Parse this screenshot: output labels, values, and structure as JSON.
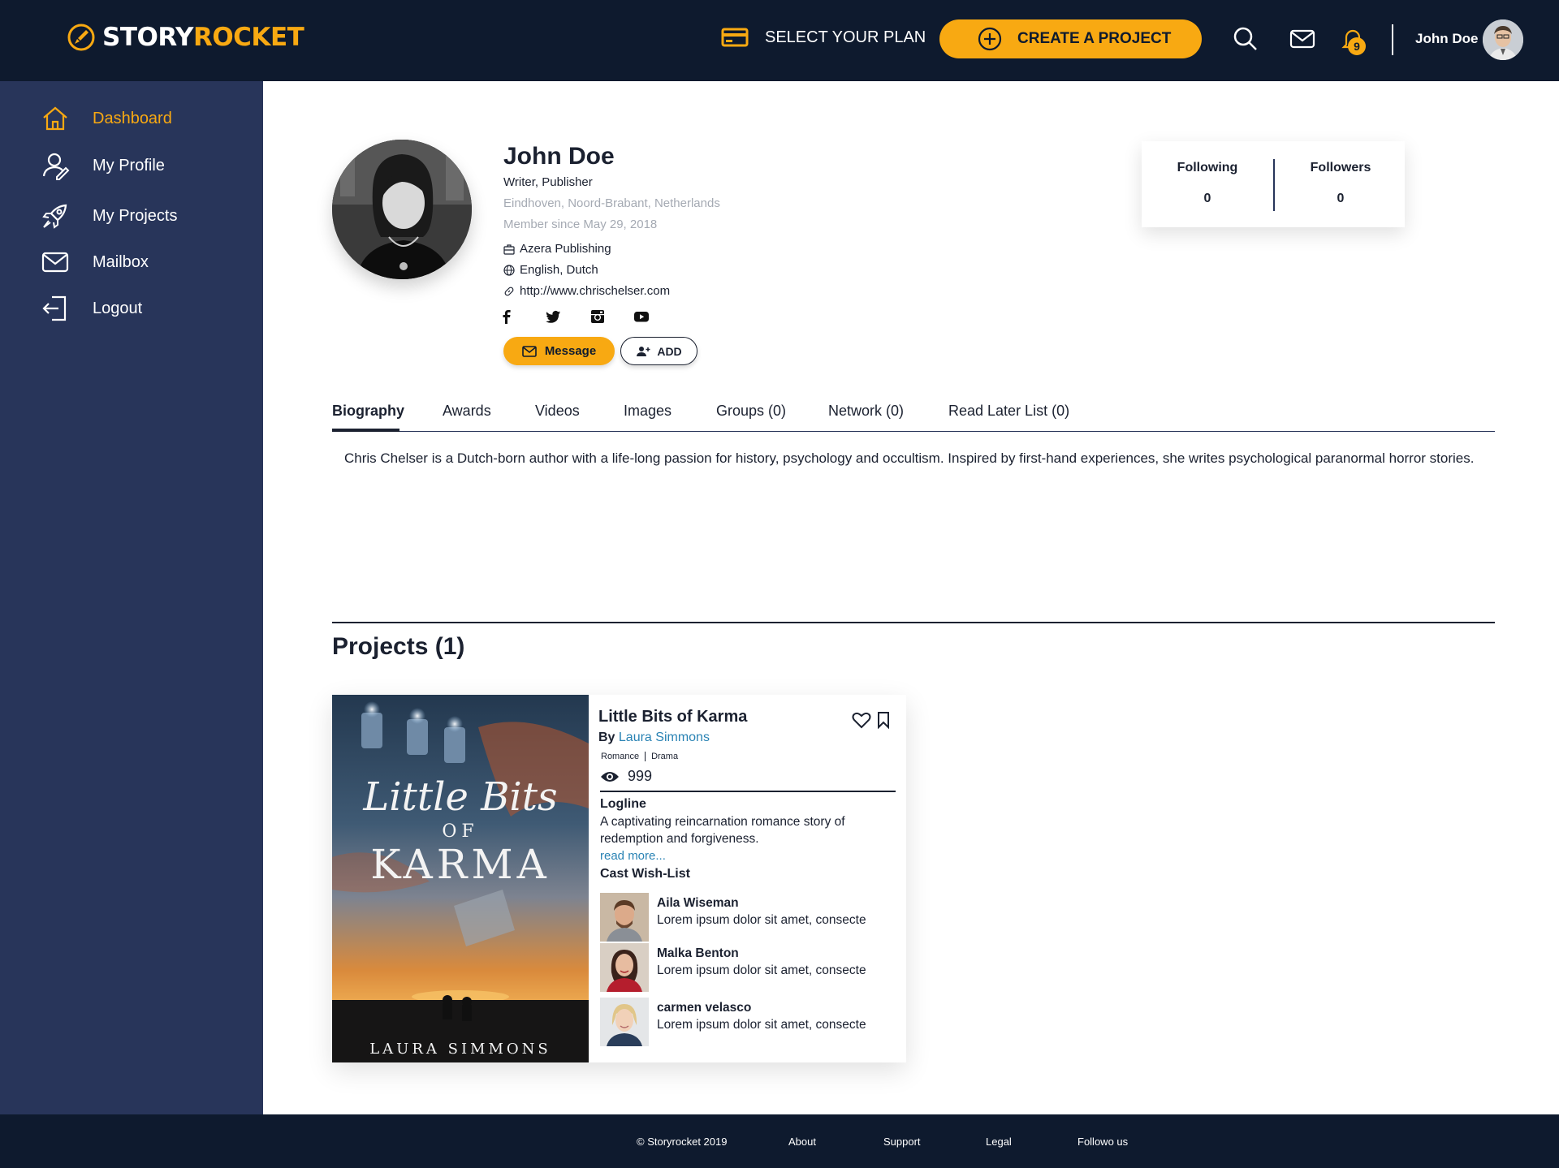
{
  "brand": {
    "name_part1": "STORY",
    "name_part2": "ROCKET",
    "accent": "#f8a912",
    "dark": "#0e1a2e",
    "sidebar_bg": "#28355a"
  },
  "header": {
    "plan_label": "SELECT YOUR PLAN",
    "create_label": "CREATE A PROJECT",
    "notification_count": "9",
    "user_name": "John Doe"
  },
  "sidebar": {
    "items": [
      {
        "label": "Dashboard",
        "icon": "home-icon"
      },
      {
        "label": "My Profile",
        "icon": "user-icon"
      },
      {
        "label": "My Projects",
        "icon": "rocket-icon"
      },
      {
        "label": "Mailbox",
        "icon": "mail-icon"
      },
      {
        "label": "Logout",
        "icon": "logout-icon"
      }
    ]
  },
  "profile": {
    "name": "John Doe",
    "role": "Writer, Publisher",
    "location": "Eindhoven, Noord-Brabant, Netherlands",
    "member_since": "Member since May 29, 2018",
    "company": "Azera Publishing",
    "languages": "English, Dutch",
    "website": "http://www.chrischelser.com",
    "message_label": "Message",
    "add_label": "ADD",
    "following_label": "Following",
    "following_count": "0",
    "followers_label": "Followers",
    "followers_count": "0"
  },
  "tabs": [
    "Biography",
    "Awards",
    "Videos",
    "Images",
    "Groups (0)",
    "Network (0)",
    "Read Later List (0)"
  ],
  "biography": "Chris Chelser is a Dutch-born author with a life-long passion for history, psychology and occultism. Inspired by first-hand experiences, she writes psychological paranormal horror stories.",
  "projects": {
    "title": "Projects (1)",
    "items": [
      {
        "title": "Little Bits of Karma",
        "by_label": "By",
        "author": "Laura Simmons",
        "genres": [
          "Romance",
          "Drama"
        ],
        "views": "999",
        "cover": {
          "line1": "Little Bits",
          "line2": "OF",
          "line3": "KARMA",
          "author": "LAURA SIMMONS"
        },
        "logline_label": "Logline",
        "logline": "A captivating reincarnation romance story of redemption and forgiveness.",
        "read_more": "read more...",
        "cast_label": "Cast Wish-List",
        "cast": [
          {
            "name": "Aila Wiseman",
            "desc": "Lorem ipsum dolor sit amet, consecte"
          },
          {
            "name": "Malka Benton",
            "desc": "Lorem ipsum dolor sit amet, consecte"
          },
          {
            "name": "carmen velasco",
            "desc": "Lorem ipsum dolor sit amet, consecte"
          }
        ]
      }
    ]
  },
  "footer": {
    "copyright": "© Storyrocket 2019",
    "about": "About",
    "support": "Support",
    "legal": "Legal",
    "follow": "Followo us"
  }
}
